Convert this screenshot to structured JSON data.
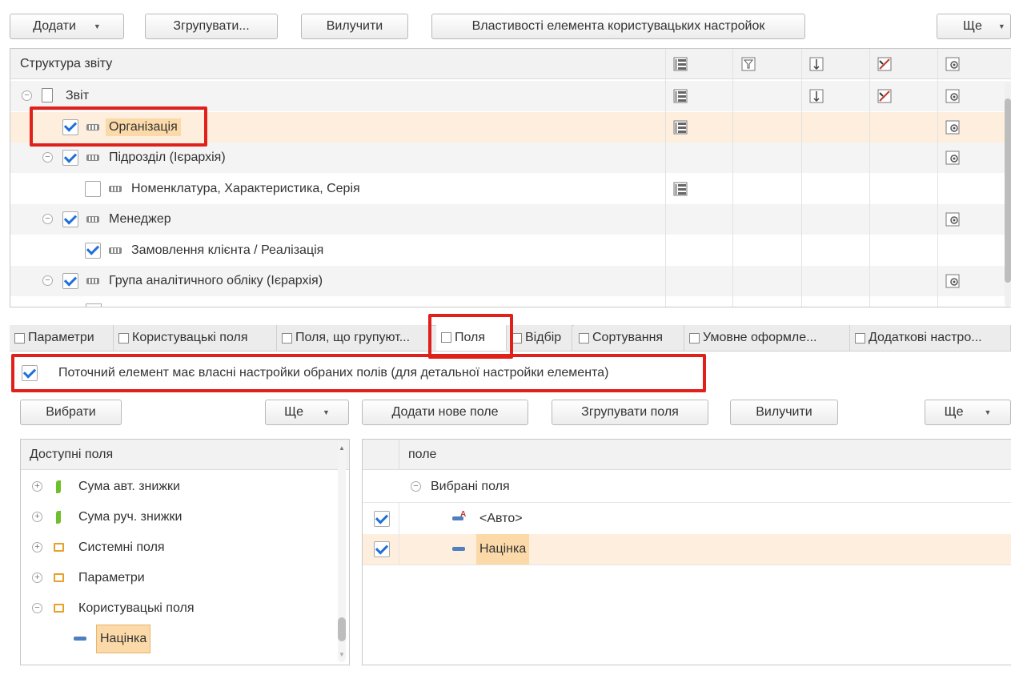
{
  "toolbar": {
    "add": "Додати",
    "group": "Згрупувати...",
    "exclude": "Вилучити",
    "properties": "Властивості елемента користувацьких настройок",
    "more": "Ще"
  },
  "structure": {
    "header": "Структура звіту",
    "columns_icons": [
      "group-fields-icon",
      "filter-icon",
      "sort-icon",
      "conditional-format-icon",
      "additional-settings-icon"
    ],
    "rows": [
      {
        "label": "Звіт",
        "level": 0,
        "toggle": "⊖",
        "checkbox": null,
        "icons": [
          1,
          0,
          1,
          1,
          1
        ],
        "highlight": false
      },
      {
        "label": "Організація",
        "level": 1,
        "toggle": null,
        "checkbox": true,
        "icons": [
          1,
          0,
          0,
          0,
          1
        ],
        "highlight": true
      },
      {
        "label": "Підрозділ (Ієрархія)",
        "level": 1,
        "toggle": "⊖",
        "checkbox": true,
        "icons": [
          0,
          0,
          0,
          0,
          1
        ],
        "highlight": false
      },
      {
        "label": "Номенклатура, Характеристика, Серія",
        "level": 2,
        "toggle": null,
        "checkbox": false,
        "icons": [
          1,
          0,
          0,
          0,
          0
        ],
        "highlight": false
      },
      {
        "label": "Менеджер",
        "level": 1,
        "toggle": "⊖",
        "checkbox": true,
        "icons": [
          0,
          0,
          0,
          0,
          1
        ],
        "highlight": false
      },
      {
        "label": "Замовлення клієнта / Реалізація",
        "level": 2,
        "toggle": null,
        "checkbox": true,
        "icons": [
          0,
          0,
          0,
          0,
          0
        ],
        "highlight": false
      },
      {
        "label": "Група аналітичного обліку (Ієрархія)",
        "level": 1,
        "toggle": "⊖",
        "checkbox": true,
        "icons": [
          0,
          0,
          0,
          0,
          1
        ],
        "highlight": false
      }
    ]
  },
  "tabs": [
    {
      "label": "Параметри",
      "active": false
    },
    {
      "label": "Користувацькі поля",
      "active": false
    },
    {
      "label": "Поля, що групуют...",
      "active": false
    },
    {
      "label": "Поля",
      "active": true
    },
    {
      "label": "Відбір",
      "active": false
    },
    {
      "label": "Сортування",
      "active": false
    },
    {
      "label": "Умовне оформле...",
      "active": false
    },
    {
      "label": "Додаткові настро...",
      "active": false
    }
  ],
  "own_settings": {
    "checked": true,
    "label": "Поточний елемент має власні настройки обраних полів (для детальної настройки елемента)"
  },
  "left_panel": {
    "select_button": "Вибрати",
    "more": "Ще",
    "header": "Доступні поля",
    "items": [
      {
        "label": "Сума авт. знижки",
        "icon": "leaf-icon",
        "toggle": "⊕"
      },
      {
        "label": "Сума руч. знижки",
        "icon": "leaf-icon",
        "toggle": "⊕"
      },
      {
        "label": "Системні поля",
        "icon": "folder-icon",
        "toggle": "⊕"
      },
      {
        "label": "Параметри",
        "icon": "folder-icon",
        "toggle": "⊕"
      },
      {
        "label": "Користувацькі поля",
        "icon": "folder-icon",
        "toggle": "⊖"
      },
      {
        "label": "Націнка",
        "icon": "field-icon",
        "toggle": null
      }
    ]
  },
  "right_panel": {
    "add_field": "Додати нове поле",
    "group_fields": "Згрупувати поля",
    "exclude": "Вилучити",
    "more": "Ще",
    "header": "поле",
    "group_label": "Вибрані поля",
    "items": [
      {
        "label": "<Авто>",
        "checked": true,
        "icon": "auto-field-icon"
      },
      {
        "label": "Націнка",
        "checked": true,
        "icon": "field-icon"
      }
    ]
  },
  "colors": {
    "highlight": "#fdeedd",
    "selection": "#fbd9a8",
    "red_annotation": "#e0201a",
    "check_blue": "#1e6fd9"
  }
}
